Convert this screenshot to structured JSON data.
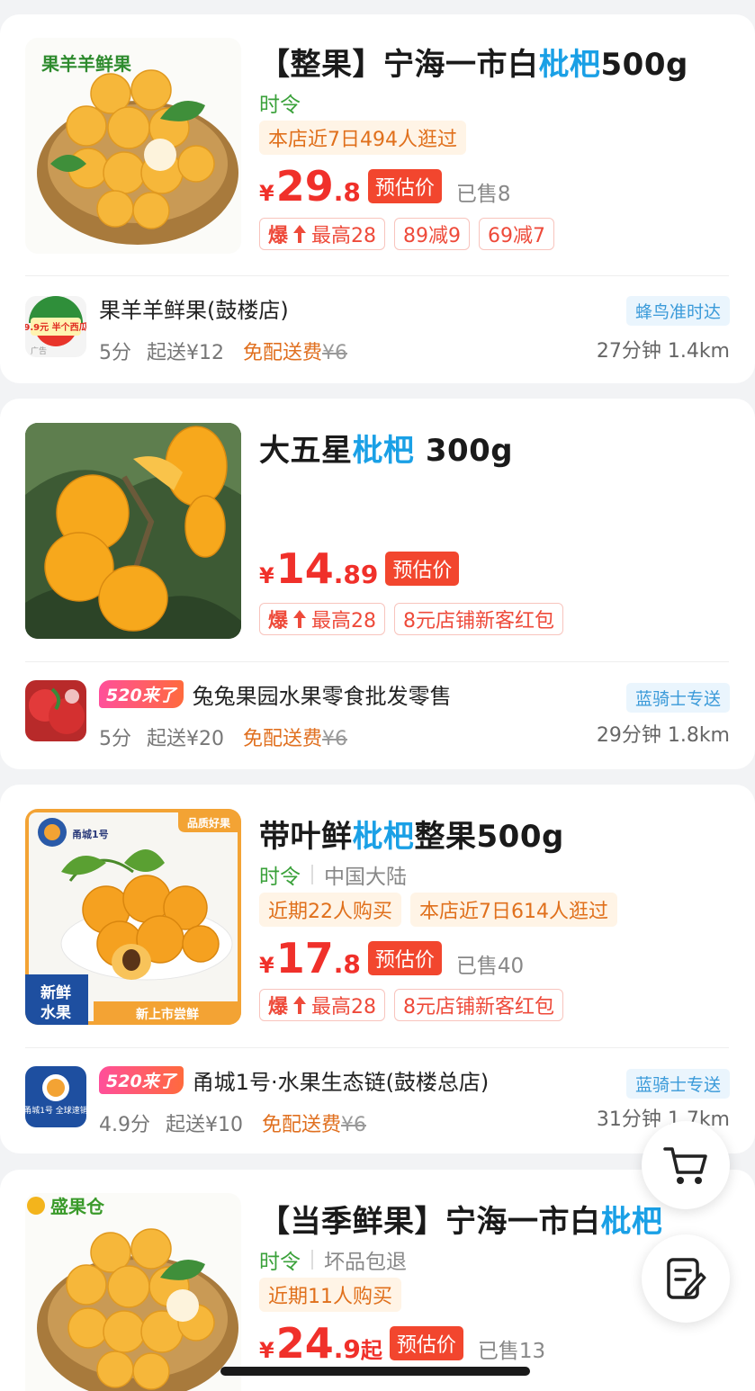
{
  "products": [
    {
      "title_pre": "【整果】宁海一市白",
      "title_hl": "枇杷",
      "title_post": "500g",
      "image_text": "果羊羊鲜果",
      "season": "时令",
      "origin": "",
      "tags": [
        "本店近7日494人逛过"
      ],
      "price_int": "29",
      "price_dec": ".8",
      "price_qi": "",
      "est_label": "预估价",
      "sold": "已售8",
      "promos": [
        "最高28",
        "89减9",
        "69减7"
      ],
      "shop": {
        "logo_text": "9.9元 半个西瓜",
        "ad_label": "广告",
        "badge": "",
        "name": "果羊羊鲜果(鼓楼店)",
        "rating": "5分",
        "min_order": "起送¥12",
        "free_delivery": "免配送费",
        "orig_fee": "¥6",
        "delivery_tag": "蜂鸟准时达",
        "time_dist": "27分钟 1.4km"
      }
    },
    {
      "title_pre": "大五星",
      "title_hl": "枇杷",
      "title_post": " 300g",
      "image_text": "",
      "season": "",
      "origin": "",
      "tags": [],
      "price_int": "14",
      "price_dec": ".89",
      "price_qi": "",
      "est_label": "预估价",
      "sold": "",
      "promos": [
        "最高28",
        "8元店铺新客红包"
      ],
      "shop": {
        "logo_text": "",
        "ad_label": "",
        "badge": "520来了",
        "name": "兔兔果园水果零食批发零售",
        "rating": "5分",
        "min_order": "起送¥20",
        "free_delivery": "免配送费",
        "orig_fee": "¥6",
        "delivery_tag": "蓝骑士专送",
        "time_dist": "29分钟 1.8km"
      }
    },
    {
      "title_pre": "带叶鲜",
      "title_hl": "枇杷",
      "title_post": "整果500g",
      "image_texts": [
        "甬城1号",
        "品质好果",
        "新鲜",
        "水果",
        "新上市尝鲜"
      ],
      "season": "时令",
      "origin": "中国大陆",
      "tags": [
        "近期22人购买",
        "本店近7日614人逛过"
      ],
      "price_int": "17",
      "price_dec": ".8",
      "price_qi": "",
      "est_label": "预估价",
      "sold": "已售40",
      "promos": [
        "最高28",
        "8元店铺新客红包"
      ],
      "shop": {
        "logo_text": "甬城1号 全球速销",
        "ad_label": "",
        "badge": "520来了",
        "name": "甬城1号·水果生态链(鼓楼总店)",
        "rating": "4.9分",
        "min_order": "起送¥10",
        "free_delivery": "免配送费",
        "orig_fee": "¥6",
        "delivery_tag": "蓝骑士专送",
        "time_dist": "31分钟 1.7km"
      }
    },
    {
      "title_pre": "【当季鲜果】宁海一市白",
      "title_hl": "枇杷",
      "title_post": "",
      "image_text": "盛果仓",
      "season": "时令",
      "origin": "坏品包退",
      "tags": [
        "近期11人购买"
      ],
      "price_int": "24",
      "price_dec": ".9",
      "price_qi": "起",
      "est_label": "预估价",
      "sold": "已售13",
      "promos": []
    }
  ],
  "fire_label": "爆",
  "colors": {
    "price": "#f0302a",
    "highlight": "#1aa0e6",
    "season": "#3aa13a",
    "accent": "#e07020"
  },
  "fabs": {
    "cart": "cart-icon",
    "note": "edit-note-icon"
  }
}
